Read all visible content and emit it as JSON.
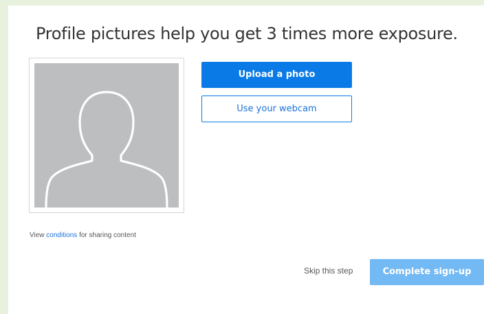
{
  "headline": "Profile pictures help you get 3 times more exposure.",
  "photo_placeholder": {
    "icon": "default-avatar-silhouette",
    "background_color": "#bdbec0"
  },
  "actions": {
    "upload_label": "Upload a photo",
    "webcam_label": "Use your webcam"
  },
  "conditions": {
    "prefix": "View ",
    "link_text": "conditions",
    "suffix": " for sharing content"
  },
  "footer": {
    "skip_label": "Skip this step",
    "complete_label": "Complete sign-up"
  },
  "colors": {
    "primary": "#0a7be6",
    "primary_disabled": "#73b9f4",
    "link": "#1a73d9",
    "page_background": "#e8f1dd"
  }
}
